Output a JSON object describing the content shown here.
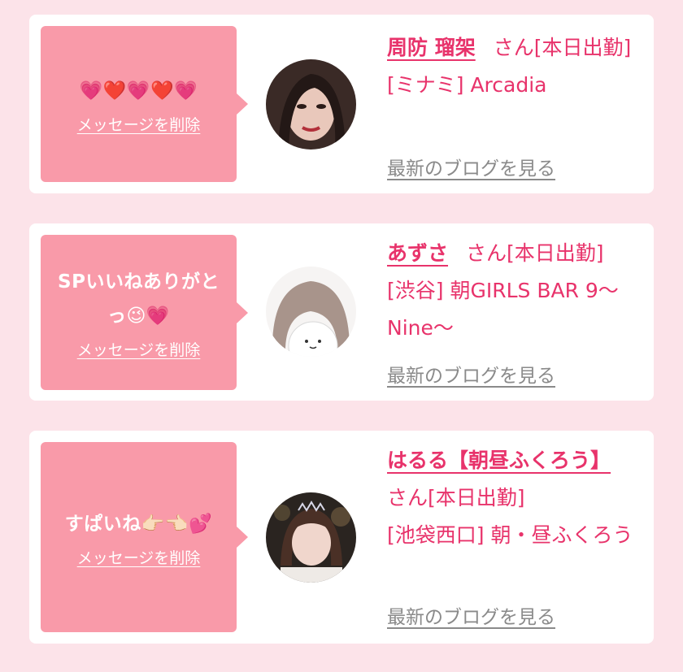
{
  "colors": {
    "background": "#fce3e9",
    "bubble": "#f99aa9",
    "accent": "#e8336b",
    "blog_link": "#8a8a8a"
  },
  "items": [
    {
      "message": "💗❤️💗❤️💗",
      "delete_label": "メッセージを削除",
      "name": "周防 瑠架",
      "suffix": "さん[本日出勤]",
      "shop": "[ミナミ] Arcadia",
      "blog_label": "最新のブログを見る"
    },
    {
      "message": "SPいいねありがとっ😉💗",
      "delete_label": "メッセージを削除",
      "name": "あずさ",
      "suffix": "さん[本日出勤]",
      "shop": "[渋谷] 朝GIRLS BAR 9〜Nine〜",
      "blog_label": "最新のブログを見る"
    },
    {
      "message": "すぱいね👉🏻👈🏻💕",
      "delete_label": "メッセージを削除",
      "name": "はるる【朝昼ふくろう】",
      "suffix": "さん[本日出勤]",
      "shop": "[池袋西口] 朝・昼ふくろう",
      "blog_label": "最新のブログを見る"
    }
  ]
}
